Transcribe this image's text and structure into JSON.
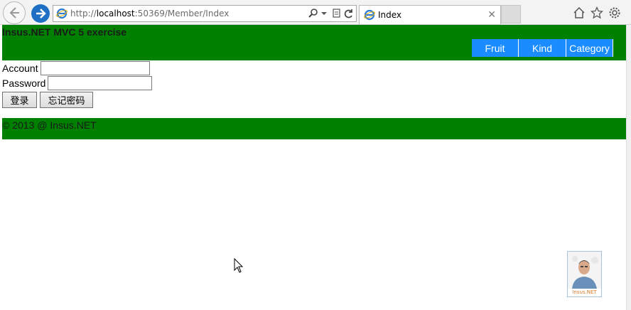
{
  "browser": {
    "url_prefix": "http://",
    "url_host": "localhost",
    "url_rest": ":50369/Member/Index",
    "tab_title": "Index",
    "tab_close": "✕",
    "icons": [
      "back-icon",
      "forward-icon",
      "ie-page-icon",
      "search-icon",
      "dropdown-icon",
      "compat-view-icon",
      "refresh-icon",
      "home-icon",
      "favorites-star-icon",
      "settings-gear-icon"
    ]
  },
  "site": {
    "title": "Insus.NET MVC 5 exercise",
    "menu": [
      {
        "label": "Fruit"
      },
      {
        "label": "Kind"
      },
      {
        "label": "Category"
      }
    ],
    "header_color": "#008000",
    "menu_color": "#1a8cff"
  },
  "form": {
    "account_label": "Account",
    "account_value": "",
    "password_label": "Password",
    "password_value": "",
    "login_button": "登录",
    "forgot_button": "忘记密码"
  },
  "footer": {
    "copyright": "© 2013 @ Insus.NET"
  },
  "avatar": {
    "caption": "Insus.NET"
  }
}
